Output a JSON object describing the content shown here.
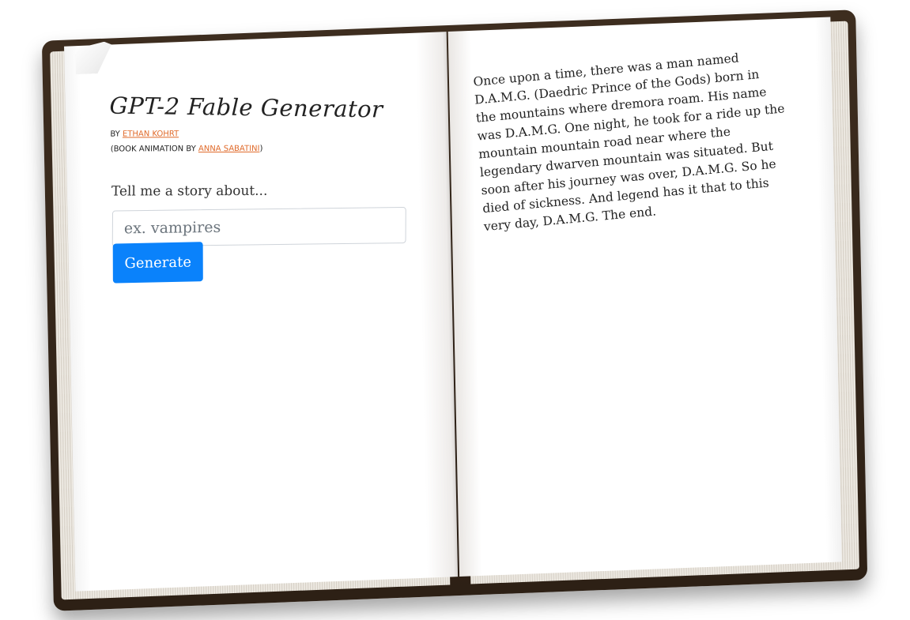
{
  "app": {
    "title": "GPT-2 Fable Generator",
    "byline_prefix": "By",
    "author_name": "Ethan Kohrt",
    "animation_prefix": "(Book animation by",
    "animator_name": "Anna Sabatini",
    "animation_suffix": ")"
  },
  "form": {
    "prompt_label": "Tell me a story about...",
    "input_value": "",
    "input_placeholder": "ex. vampires",
    "button_label": "Generate"
  },
  "story": {
    "text": "Once upon a time, there was a man named D.A.M.G. (Daedric Prince of the Gods) born in the mountains where dremora roam. His name was D.A.M.G. One night, he took for a ride up the mountain mountain road near where the legendary dwarven mountain was situated. But soon after his journey was over, D.A.M.G. So he died of sickness. And legend has it that to this very day, D.A.M.G. The end."
  },
  "colors": {
    "accent": "#0a82fb",
    "link": "#e06a2a",
    "cover": "#2d2015"
  }
}
